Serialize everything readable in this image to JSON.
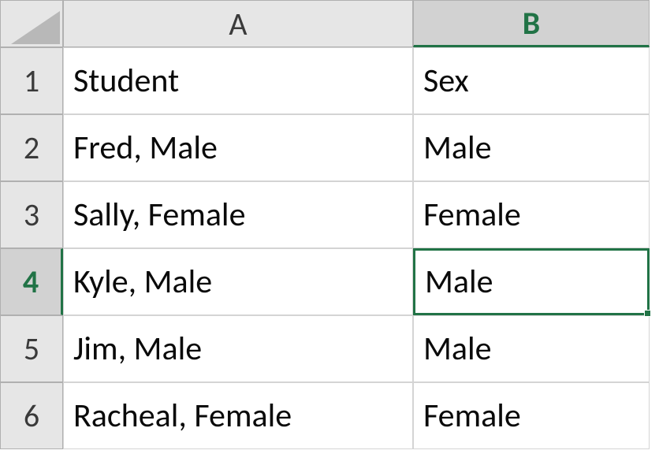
{
  "columns": [
    "A",
    "B"
  ],
  "rows": [
    "1",
    "2",
    "3",
    "4",
    "5",
    "6"
  ],
  "selected": {
    "row": 4,
    "col": "B"
  },
  "data": {
    "A1": "Student",
    "B1": "Sex",
    "A2": "Fred, Male",
    "B2": "Male",
    "A3": "Sally, Female",
    "B3": "Female",
    "A4": "Kyle, Male",
    "B4": "Male",
    "A5": "Jim, Male",
    "B5": "Male",
    "A6": "Racheal, Female",
    "B6": "Female"
  }
}
